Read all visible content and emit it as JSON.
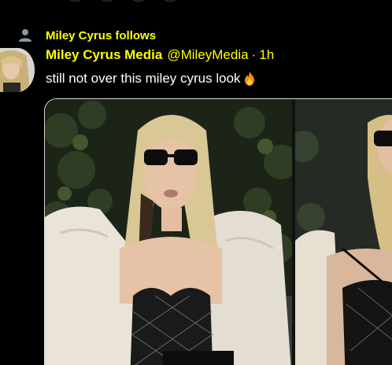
{
  "social_context": {
    "text": "Miley Cyrus follows"
  },
  "tweet": {
    "display_name": "Miley Cyrus Media",
    "handle": "@MileyMedia",
    "separator": "·",
    "time": "1h",
    "text": "still not over this miley cyrus look"
  },
  "icons": {
    "social_context": "person-icon",
    "emoji": "fire-icon"
  },
  "colors": {
    "background": "#000000",
    "accent": "#ffff00",
    "text": "#ffffff",
    "media_border": "#d9d9d9"
  }
}
